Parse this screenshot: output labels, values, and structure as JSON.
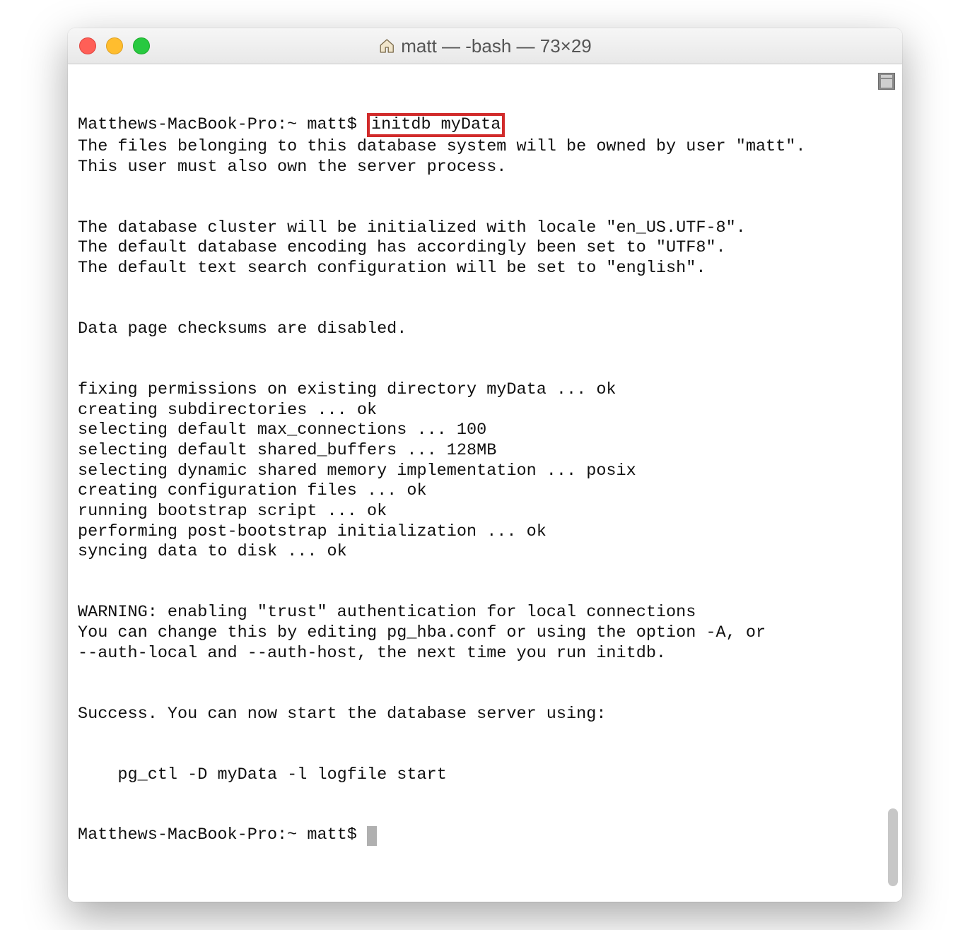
{
  "window": {
    "title": "matt — -bash — 73×29"
  },
  "term": {
    "prompt1_prefix": "Matthews-MacBook-Pro:~ matt$ ",
    "highlighted_command": "initdb myData",
    "output_before_blank1": "The files belonging to this database system will be owned by user \"matt\".\nThis user must also own the server process.",
    "output_block2": "The database cluster will be initialized with locale \"en_US.UTF-8\".\nThe default database encoding has accordingly been set to \"UTF8\".\nThe default text search configuration will be set to \"english\".",
    "output_block3": "Data page checksums are disabled.",
    "output_block4": "fixing permissions on existing directory myData ... ok\ncreating subdirectories ... ok\nselecting default max_connections ... 100\nselecting default shared_buffers ... 128MB\nselecting dynamic shared memory implementation ... posix\ncreating configuration files ... ok\nrunning bootstrap script ... ok\nperforming post-bootstrap initialization ... ok\nsyncing data to disk ... ok",
    "output_block5": "WARNING: enabling \"trust\" authentication for local connections\nYou can change this by editing pg_hba.conf or using the option -A, or\n--auth-local and --auth-host, the next time you run initdb.",
    "output_block6": "Success. You can now start the database server using:",
    "output_block7": "    pg_ctl -D myData -l logfile start",
    "prompt2_prefix": "Matthews-MacBook-Pro:~ matt$ "
  }
}
